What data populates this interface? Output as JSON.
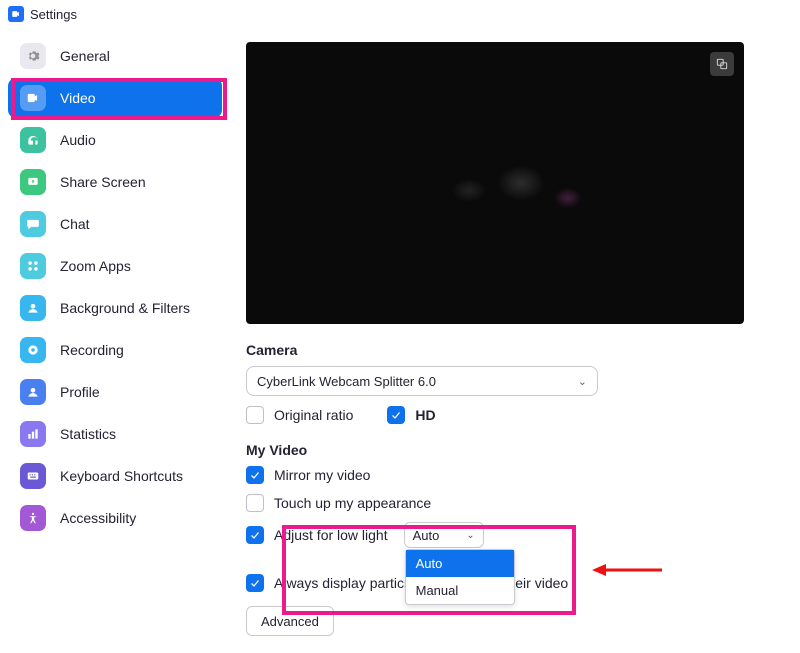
{
  "window": {
    "title": "Settings"
  },
  "sidebar": {
    "items": [
      {
        "label": "General"
      },
      {
        "label": "Video"
      },
      {
        "label": "Audio"
      },
      {
        "label": "Share Screen"
      },
      {
        "label": "Chat"
      },
      {
        "label": "Zoom Apps"
      },
      {
        "label": "Background & Filters"
      },
      {
        "label": "Recording"
      },
      {
        "label": "Profile"
      },
      {
        "label": "Statistics"
      },
      {
        "label": "Keyboard Shortcuts"
      },
      {
        "label": "Accessibility"
      }
    ],
    "active_index": 1
  },
  "camera": {
    "section_label": "Camera",
    "selected": "CyberLink Webcam Splitter 6.0",
    "original_ratio": {
      "label": "Original ratio",
      "checked": false
    },
    "hd": {
      "label": "HD",
      "checked": true
    }
  },
  "my_video": {
    "section_label": "My Video",
    "mirror": {
      "label": "Mirror my video",
      "checked": true
    },
    "touchup": {
      "label": "Touch up my appearance",
      "checked": false
    },
    "lowlight": {
      "label": "Adjust for low light",
      "checked": true,
      "selected": "Auto",
      "options": [
        "Auto",
        "Manual"
      ]
    },
    "always_display": {
      "label_prefix": "Always display partici",
      "label_suffix": "their video",
      "checked": true
    }
  },
  "advanced_label": "Advanced"
}
